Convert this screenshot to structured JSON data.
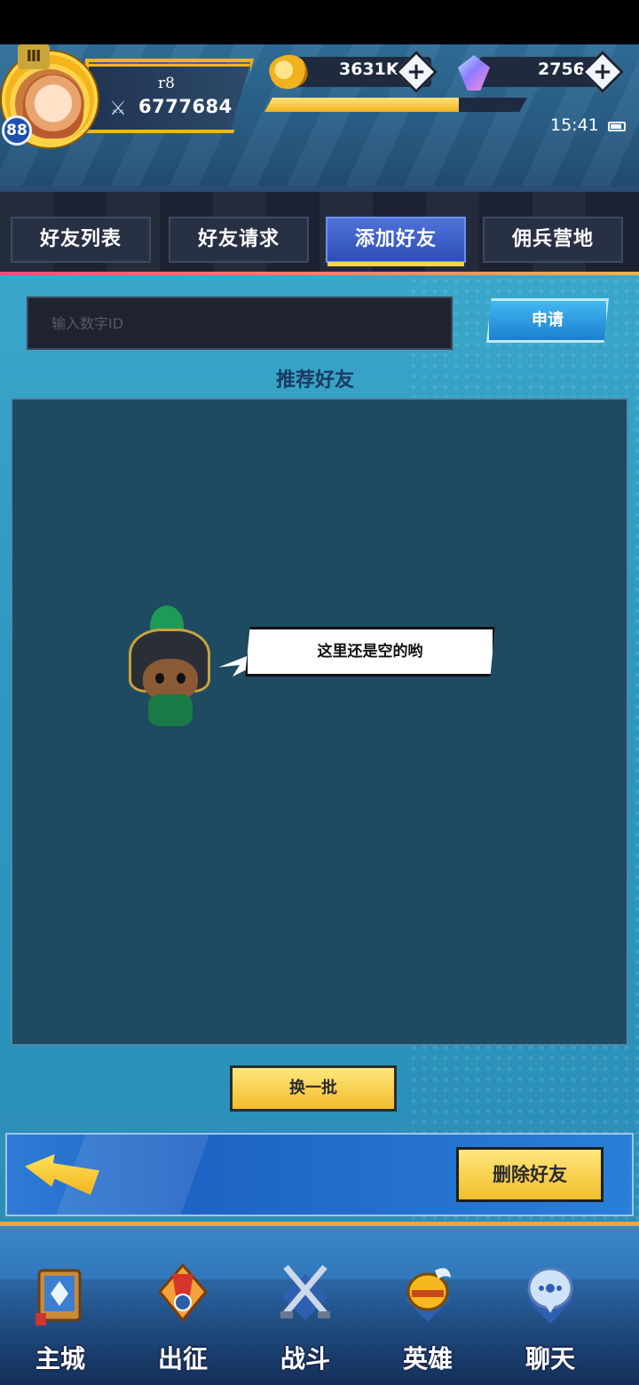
{
  "header": {
    "player_name": "r8",
    "player_level": "88",
    "rank_badge": "Ⅲ",
    "power": "6777684",
    "gold": "3631K",
    "gems": "2756",
    "xp_fraction": 0.74,
    "time": "15:41",
    "plus_symbol": "+"
  },
  "tabs": [
    {
      "label": "好友列表",
      "active": false
    },
    {
      "label": "好友请求",
      "active": false
    },
    {
      "label": "添加好友",
      "active": true
    },
    {
      "label": "佣兵营地",
      "active": false
    }
  ],
  "add_friend": {
    "input_placeholder": "输入数字ID",
    "apply_label": "申请",
    "section_title": "推荐好友",
    "empty_message": "这里还是空的哟",
    "refresh_label": "换一批",
    "delete_label": "删除好友"
  },
  "nav": [
    {
      "label": "主城",
      "icon": "castle-card-icon"
    },
    {
      "label": "出征",
      "icon": "ship-icon"
    },
    {
      "label": "战斗",
      "icon": "crossed-swords-icon"
    },
    {
      "label": "英雄",
      "icon": "hero-helmet-icon"
    },
    {
      "label": "聊天",
      "icon": "chat-icon"
    }
  ],
  "colors": {
    "accent_yellow": "#f2bd2a",
    "active_tab": "#3f62c8",
    "panel_bg": "#1e4a62"
  }
}
